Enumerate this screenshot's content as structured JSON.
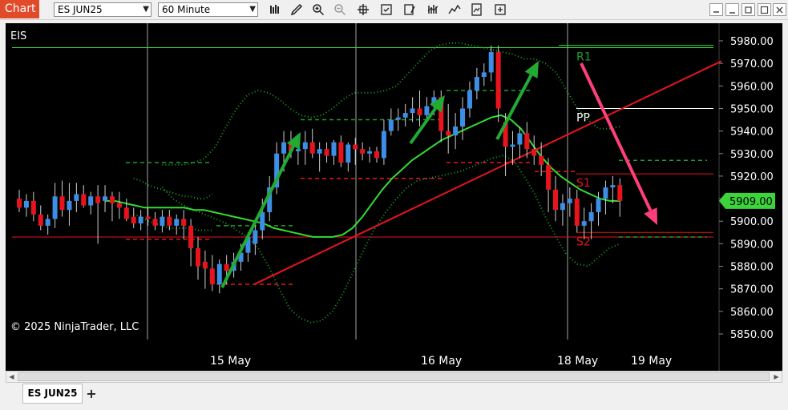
{
  "toolbar": {
    "chart_label": "Chart",
    "instrument": "ES JUN25",
    "timeframe": "60 Minute",
    "icons": [
      "bar-type-icon",
      "draw-tool-icon",
      "zoom-in-icon",
      "zoom-out-icon",
      "crosshair-icon",
      "properties-icon",
      "strategies-icon",
      "indicators-icon",
      "plot-icon",
      "templates-icon",
      "share-icon"
    ],
    "window_buttons": [
      "minimize-icon",
      "maximize-icon",
      "restore-icon",
      "close-icon"
    ]
  },
  "chart": {
    "instrument_label": "EIS",
    "copyright": "© 2025 NinjaTrader, LLC",
    "current_price": "5909.00",
    "price_axis": [
      "5980.00",
      "5970.00",
      "5960.00",
      "5950.00",
      "5940.00",
      "5930.00",
      "5920.00",
      "5910.00",
      "5900.00",
      "5890.00",
      "5880.00",
      "5870.00",
      "5860.00",
      "5850.00"
    ],
    "date_labels": [
      "15 May",
      "16 May",
      "18 May",
      "19 May"
    ],
    "pivot_labels": {
      "r1": "R1",
      "pp": "PP",
      "s1": "S1",
      "s2": "S2"
    },
    "colors": {
      "up": "#3d8ee6",
      "down": "#e8141c",
      "ma": "#33dd33",
      "band": "#1f9e2a",
      "arrow_up": "#22aa33",
      "arrow_down": "#ff3f7a",
      "trendline": "#e8141c",
      "price_tag": "#3bd43b"
    }
  },
  "chart_data": {
    "type": "candlestick",
    "ylim": [
      5845,
      5990
    ],
    "ohlc": [
      [
        5910,
        5914,
        5904,
        5906
      ],
      [
        5906,
        5912,
        5902,
        5909
      ],
      [
        5909,
        5913,
        5900,
        5903
      ],
      [
        5903,
        5907,
        5896,
        5898
      ],
      [
        5898,
        5903,
        5894,
        5901
      ],
      [
        5901,
        5917,
        5897,
        5911
      ],
      [
        5911,
        5918,
        5902,
        5905
      ],
      [
        5905,
        5917,
        5898,
        5909
      ],
      [
        5909,
        5917,
        5904,
        5912
      ],
      [
        5912,
        5916,
        5906,
        5907
      ],
      [
        5907,
        5913,
        5903,
        5911
      ],
      [
        5911,
        5916,
        5890,
        5908
      ],
      [
        5909,
        5916,
        5904,
        5911
      ],
      [
        5911,
        5913,
        5900,
        5908
      ],
      [
        5908,
        5913,
        5901,
        5906
      ],
      [
        5906,
        5910,
        5900,
        5901
      ],
      [
        5902,
        5906,
        5897,
        5899
      ],
      [
        5899,
        5905,
        5896,
        5902
      ],
      [
        5902,
        5906,
        5898,
        5901
      ],
      [
        5901,
        5904,
        5896,
        5898
      ],
      [
        5898,
        5905,
        5895,
        5902
      ],
      [
        5902,
        5905,
        5896,
        5898
      ],
      [
        5898,
        5903,
        5894,
        5901
      ],
      [
        5901,
        5905,
        5892,
        5898
      ],
      [
        5898,
        5901,
        5880,
        5888
      ],
      [
        5888,
        5893,
        5874,
        5880
      ],
      [
        5882,
        5887,
        5870,
        5879
      ],
      [
        5879,
        5885,
        5869,
        5872
      ],
      [
        5872,
        5883,
        5868,
        5881
      ],
      [
        5881,
        5885,
        5872,
        5878
      ],
      [
        5878,
        5886,
        5875,
        5882
      ],
      [
        5882,
        5890,
        5878,
        5886
      ],
      [
        5886,
        5895,
        5882,
        5893
      ],
      [
        5890,
        5901,
        5885,
        5896
      ],
      [
        5896,
        5910,
        5892,
        5904
      ],
      [
        5904,
        5920,
        5900,
        5915
      ],
      [
        5915,
        5935,
        5912,
        5930
      ],
      [
        5930,
        5940,
        5922,
        5935
      ],
      [
        5935,
        5940,
        5928,
        5931
      ],
      [
        5931,
        5935,
        5925,
        5932
      ],
      [
        5932,
        5940,
        5925,
        5935
      ],
      [
        5935,
        5941,
        5928,
        5930
      ],
      [
        5930,
        5935,
        5922,
        5932
      ],
      [
        5932,
        5935,
        5926,
        5929
      ],
      [
        5929,
        5936,
        5925,
        5935
      ],
      [
        5935,
        5938,
        5924,
        5926
      ],
      [
        5926,
        5935,
        5922,
        5934
      ],
      [
        5934,
        5937,
        5925,
        5932
      ],
      [
        5932,
        5935,
        5927,
        5930
      ],
      [
        5930,
        5933,
        5926,
        5931
      ],
      [
        5931,
        5933,
        5926,
        5928
      ],
      [
        5928,
        5945,
        5925,
        5940
      ],
      [
        5940,
        5950,
        5938,
        5945
      ],
      [
        5945,
        5950,
        5940,
        5946
      ],
      [
        5946,
        5952,
        5942,
        5948
      ],
      [
        5948,
        5955,
        5944,
        5950
      ],
      [
        5950,
        5958,
        5942,
        5947
      ],
      [
        5947,
        5955,
        5944,
        5951
      ],
      [
        5951,
        5958,
        5947,
        5955
      ],
      [
        5955,
        5958,
        5935,
        5940
      ],
      [
        5940,
        5952,
        5930,
        5938
      ],
      [
        5938,
        5948,
        5932,
        5942
      ],
      [
        5942,
        5955,
        5936,
        5950
      ],
      [
        5950,
        5962,
        5946,
        5958
      ],
      [
        5958,
        5968,
        5954,
        5964
      ],
      [
        5964,
        5970,
        5960,
        5966
      ],
      [
        5966,
        5978,
        5962,
        5975
      ],
      [
        5975,
        5978,
        5944,
        5950
      ],
      [
        5944,
        5948,
        5920,
        5933
      ],
      [
        5933,
        5940,
        5925,
        5934
      ],
      [
        5934,
        5942,
        5928,
        5939
      ],
      [
        5939,
        5944,
        5928,
        5932
      ],
      [
        5932,
        5938,
        5925,
        5929
      ],
      [
        5929,
        5935,
        5920,
        5925
      ],
      [
        5925,
        5928,
        5904,
        5914
      ],
      [
        5914,
        5920,
        5900,
        5905
      ],
      [
        5905,
        5912,
        5898,
        5908
      ],
      [
        5908,
        5915,
        5902,
        5910
      ],
      [
        5910,
        5914,
        5895,
        5898
      ],
      [
        5898,
        5906,
        5892,
        5900
      ],
      [
        5900,
        5908,
        5892,
        5904
      ],
      [
        5904,
        5913,
        5898,
        5910
      ],
      [
        5910,
        5918,
        5903,
        5915
      ],
      [
        5915,
        5920,
        5908,
        5916
      ],
      [
        5916,
        5919,
        5902,
        5909
      ]
    ],
    "moving_average": [
      5909,
      5909,
      5908,
      5907,
      5906,
      5906,
      5906,
      5906,
      5906,
      5905,
      5905,
      5904,
      5903,
      5902,
      5901,
      5900,
      5899,
      5897,
      5896,
      5895,
      5894,
      5893,
      5893,
      5893,
      5894,
      5897,
      5902,
      5908,
      5914,
      5919,
      5923,
      5927,
      5930,
      5933,
      5936,
      5938,
      5940,
      5942,
      5944,
      5946,
      5947,
      5945,
      5941,
      5935,
      5929,
      5924,
      5920,
      5917,
      5914,
      5912,
      5910,
      5909,
      5909
    ],
    "ma_start": 12,
    "upper_band": [
      5925,
      5925,
      5925,
      5926,
      5928,
      5933,
      5942,
      5950,
      5956,
      5958,
      5957,
      5954,
      5950,
      5947,
      5946,
      5947,
      5950,
      5954,
      5957,
      5957,
      5957,
      5958,
      5960,
      5965,
      5970,
      5975,
      5978,
      5979,
      5979,
      5978,
      5977,
      5976,
      5975,
      5974,
      5972,
      5972,
      5970,
      5966,
      5958,
      5950,
      5945,
      5941,
      5941,
      5942
    ],
    "lower_band": [
      5915,
      5910,
      5907,
      5905,
      5903,
      5901,
      5899,
      5896,
      5893,
      5888,
      5880,
      5870,
      5861,
      5857,
      5855,
      5856,
      5860,
      5868,
      5878,
      5888,
      5897,
      5904,
      5910,
      5915,
      5918,
      5919,
      5920,
      5921,
      5922,
      5924,
      5926,
      5928,
      5929,
      5927,
      5920,
      5912,
      5902,
      5893,
      5885,
      5881,
      5880,
      5884,
      5888,
      5890
    ],
    "band_start": 20,
    "trendline": [
      [
        5872,
        27
      ],
      [
        5971,
        84
      ]
    ],
    "pivots": {
      "R1": 5977,
      "PP": 5950,
      "S1": 5921,
      "S2": 5895
    }
  }
}
